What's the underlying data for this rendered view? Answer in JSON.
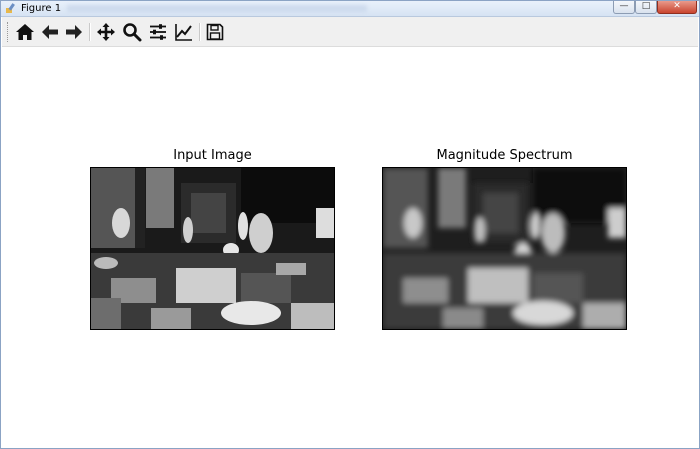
{
  "window": {
    "title": "Figure 1"
  },
  "toolbar": {
    "icons": [
      "home-icon",
      "back-icon",
      "forward-icon",
      "pan-icon",
      "zoom-icon",
      "configure-subplots-icon",
      "edit-axes-icon",
      "save-icon"
    ]
  },
  "figure": {
    "left_title": "Input Image",
    "right_title": "Magnitude Spectrum"
  }
}
